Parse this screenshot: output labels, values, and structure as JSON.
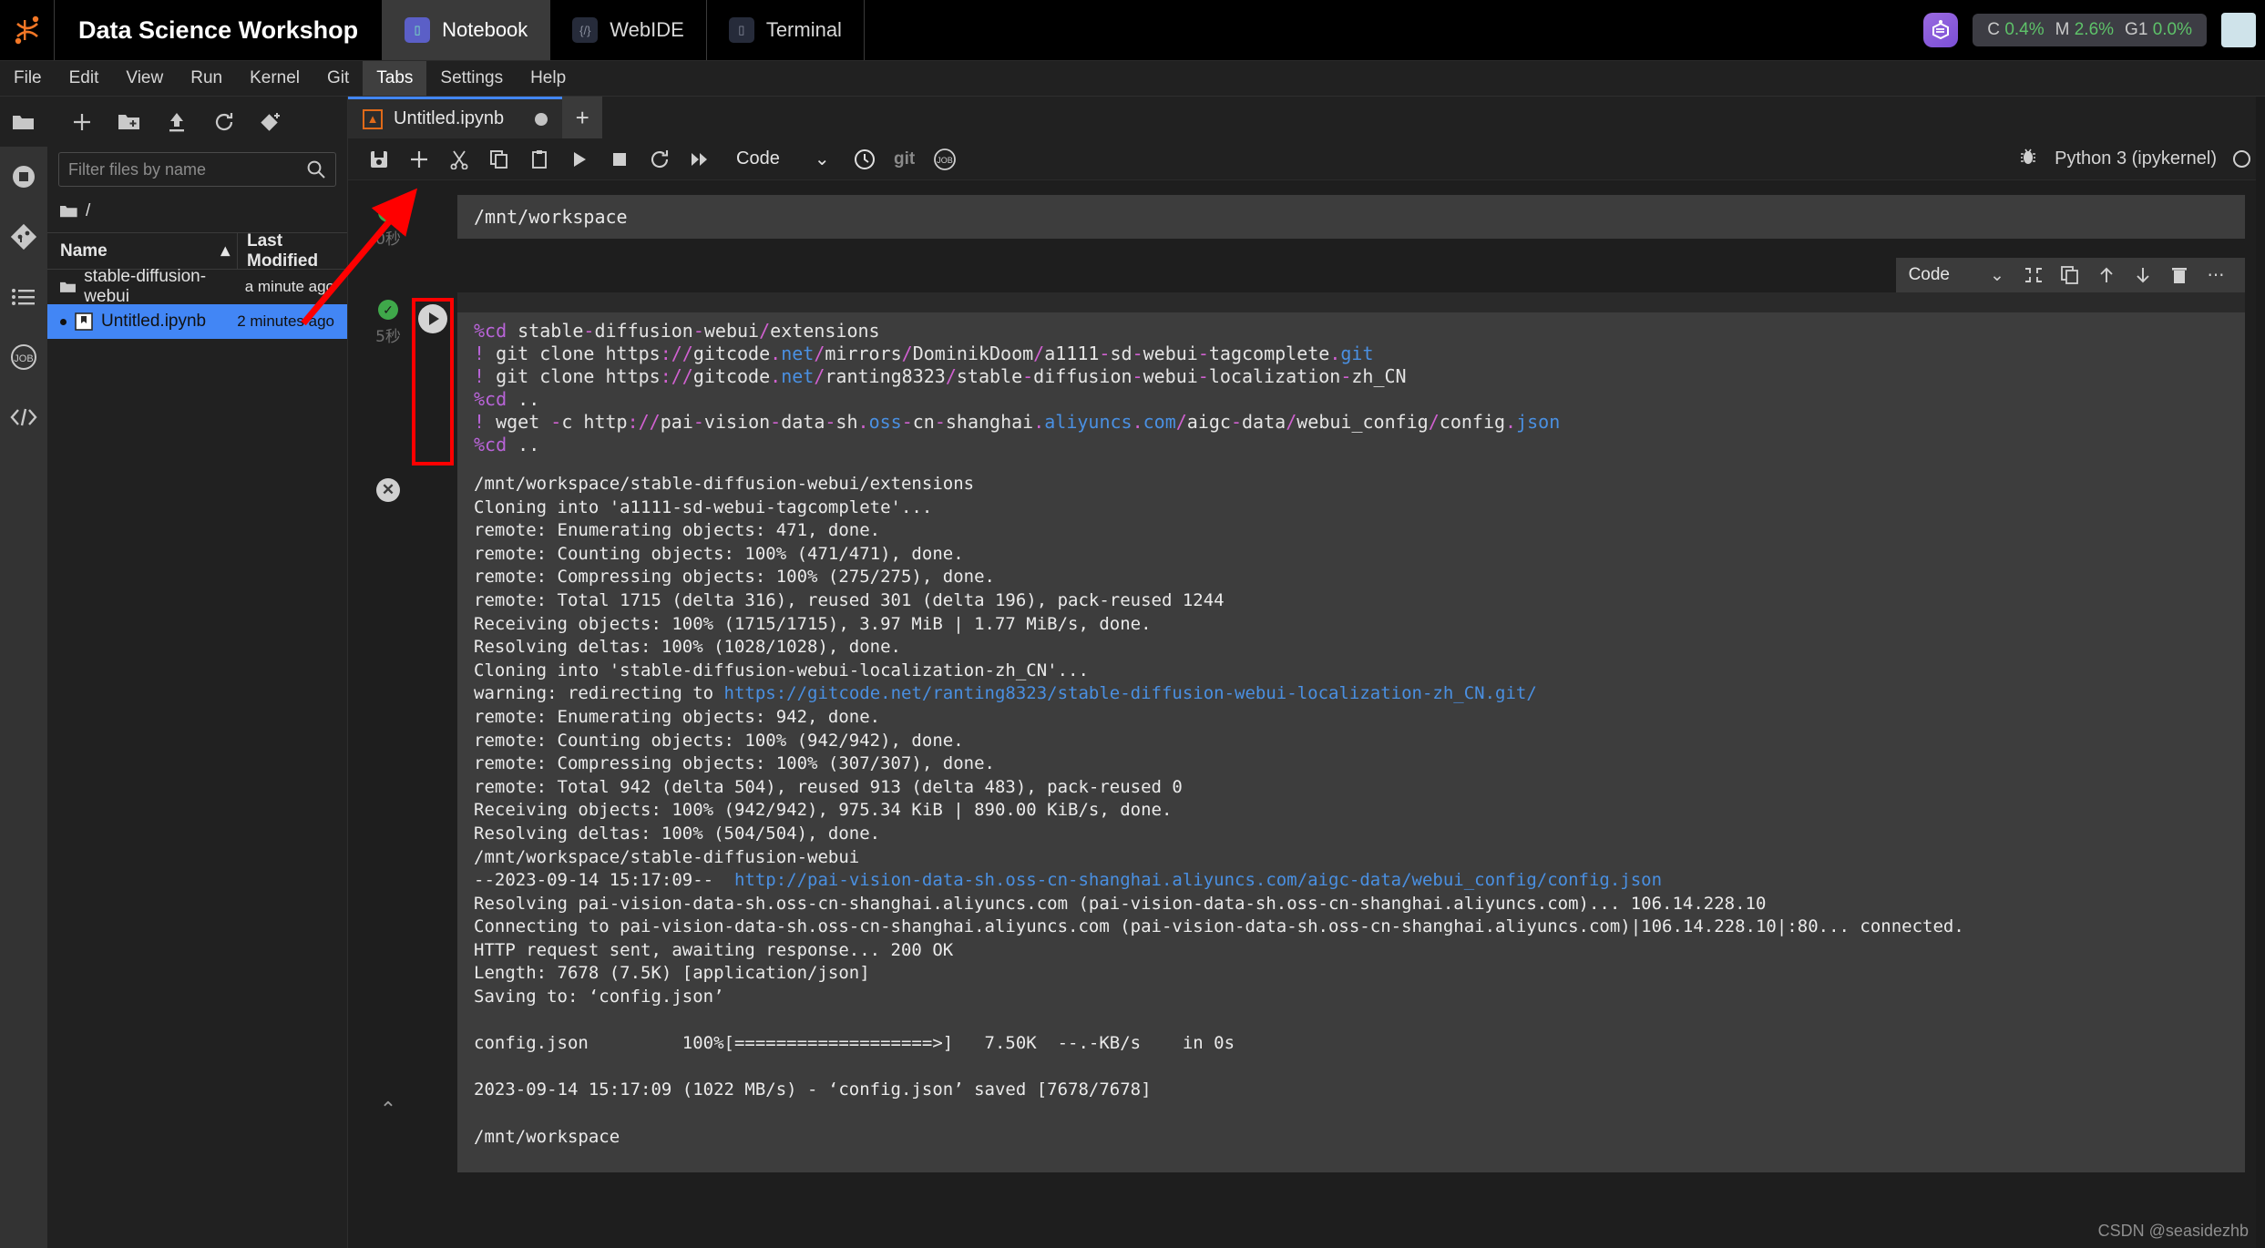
{
  "topbar": {
    "logo_icon": "jupyter-logo-icon",
    "brand": "Data Science Workshop",
    "nav": [
      {
        "label": "Notebook",
        "icon": "notebook-icon",
        "active": true
      },
      {
        "label": "WebIDE",
        "icon": "webide-icon",
        "active": false
      },
      {
        "label": "Terminal",
        "icon": "terminal-icon",
        "active": false
      }
    ],
    "resources": [
      {
        "key": "C",
        "value": "0.4%"
      },
      {
        "key": "M",
        "value": "2.6%"
      },
      {
        "key": "G1",
        "value": "0.0%"
      }
    ],
    "assistant_icon": "ai-assistant-icon",
    "avatar_icon": "user-avatar-icon"
  },
  "menubar": {
    "items": [
      "File",
      "Edit",
      "View",
      "Run",
      "Kernel",
      "Git",
      "Tabs",
      "Settings",
      "Help"
    ],
    "active": "Tabs"
  },
  "rail": {
    "items": [
      {
        "icon": "folder-icon",
        "name": "file-browser"
      },
      {
        "icon": "running-terminals-icon",
        "name": "running"
      },
      {
        "icon": "git-icon",
        "name": "git-panel"
      },
      {
        "icon": "table-of-contents-icon",
        "name": "toc"
      },
      {
        "icon": "job-icon",
        "name": "jobs"
      },
      {
        "icon": "code-extensions-icon",
        "name": "extensions"
      }
    ]
  },
  "filebrowser": {
    "toolbar": [
      {
        "icon": "new-launcher-icon",
        "name": "new-launcher"
      },
      {
        "icon": "new-folder-icon",
        "name": "new-folder"
      },
      {
        "icon": "upload-icon",
        "name": "upload"
      },
      {
        "icon": "refresh-icon",
        "name": "refresh"
      },
      {
        "icon": "new-checkpoint-icon",
        "name": "git-clone"
      }
    ],
    "filter_placeholder": "Filter files by name",
    "filter_value": "",
    "search_icon": "search-icon",
    "breadcrumb": "/",
    "columns": [
      "Name",
      "Last Modified"
    ],
    "sort_icon": "sort-asc-icon",
    "rows": [
      {
        "name": "stable-diffusion-webui",
        "modified": "a minute ago",
        "type": "folder",
        "selected": false,
        "dirty": false
      },
      {
        "name": "Untitled.ipynb",
        "modified": "2 minutes ago",
        "type": "notebook",
        "selected": true,
        "dirty": true
      }
    ]
  },
  "editor": {
    "tab": {
      "title": "Untitled.ipynb",
      "icon": "notebook-file-icon",
      "dirty": true
    },
    "add_tab_label": "+",
    "toolbar": {
      "buttons": [
        {
          "icon": "save-icon",
          "name": "save-notebook"
        },
        {
          "icon": "plus-icon",
          "name": "insert-cell"
        },
        {
          "icon": "cut-icon",
          "name": "cut-cell"
        },
        {
          "icon": "copy-icon",
          "name": "copy-cell"
        },
        {
          "icon": "paste-icon",
          "name": "paste-cell"
        },
        {
          "icon": "run-icon",
          "name": "run-cell"
        },
        {
          "icon": "stop-icon",
          "name": "interrupt-kernel"
        },
        {
          "icon": "restart-icon",
          "name": "restart-kernel"
        },
        {
          "icon": "fast-forward-icon",
          "name": "restart-run-all"
        }
      ],
      "cell_type": "Code",
      "chevron_icon": "chevron-down-icon",
      "clock_icon": "clock-icon",
      "git_label": "git",
      "job_label": "JOB",
      "debug_icon": "bug-icon",
      "kernel_name": "Python 3 (ipykernel)",
      "kernel_status_icon": "kernel-idle-icon"
    },
    "cell_toolbar": {
      "cell_type": "Code",
      "chevron_icon": "chevron-down-icon",
      "buttons": [
        {
          "icon": "collapse-icon",
          "name": "collapse-cell"
        },
        {
          "icon": "duplicate-icon",
          "name": "duplicate-cell"
        },
        {
          "icon": "move-up-icon",
          "name": "move-cell-up"
        },
        {
          "icon": "move-down-icon",
          "name": "move-cell-down"
        },
        {
          "icon": "trash-icon",
          "name": "delete-cell"
        },
        {
          "icon": "more-icon",
          "name": "more-actions"
        }
      ]
    },
    "cells": [
      {
        "status_icon": "check-success-icon",
        "exec_time": "0秒",
        "lines": [
          {
            "text": "/mnt/workspace",
            "kind": "plain"
          }
        ]
      },
      {
        "status_icon": "check-success-icon",
        "exec_time": "5秒",
        "run_button_icon": "run-cell-play-icon",
        "run_button_highlighted": true,
        "source_lines": [
          "%cd stable-diffusion-webui/extensions",
          "! git clone https://gitcode.net/mirrors/DominikDoom/a1111-sd-webui-tagcomplete.git",
          "! git clone https://gitcode.net/ranting8323/stable-diffusion-webui-localization-zh_CN",
          "%cd ..",
          "! wget -c http://pai-vision-data-sh.oss-cn-shanghai.aliyuncs.com/aigc-data/webui_config/config.json",
          "%cd .."
        ]
      }
    ],
    "output": {
      "status_icon": "error-x-icon",
      "collapse_icon": "collapse-output-icon",
      "lines": [
        "/mnt/workspace/stable-diffusion-webui/extensions",
        "Cloning into 'a1111-sd-webui-tagcomplete'...",
        "remote: Enumerating objects: 471, done.",
        "remote: Counting objects: 100% (471/471), done.",
        "remote: Compressing objects: 100% (275/275), done.",
        "remote: Total 1715 (delta 316), reused 301 (delta 196), pack-reused 1244",
        "Receiving objects: 100% (1715/1715), 3.97 MiB | 1.77 MiB/s, done.",
        "Resolving deltas: 100% (1028/1028), done.",
        "Cloning into 'stable-diffusion-webui-localization-zh_CN'...",
        "warning: redirecting to https://gitcode.net/ranting8323/stable-diffusion-webui-localization-zh_CN.git/",
        "remote: Enumerating objects: 942, done.",
        "remote: Counting objects: 100% (942/942), done.",
        "remote: Compressing objects: 100% (307/307), done.",
        "remote: Total 942 (delta 504), reused 913 (delta 483), pack-reused 0",
        "Receiving objects: 100% (942/942), 975.34 KiB | 890.00 KiB/s, done.",
        "Resolving deltas: 100% (504/504), done.",
        "/mnt/workspace/stable-diffusion-webui",
        "--2023-09-14 15:17:09--  http://pai-vision-data-sh.oss-cn-shanghai.aliyuncs.com/aigc-data/webui_config/config.json",
        "Resolving pai-vision-data-sh.oss-cn-shanghai.aliyuncs.com (pai-vision-data-sh.oss-cn-shanghai.aliyuncs.com)... 106.14.228.10",
        "Connecting to pai-vision-data-sh.oss-cn-shanghai.aliyuncs.com (pai-vision-data-sh.oss-cn-shanghai.aliyuncs.com)|106.14.228.10|:80... connected.",
        "HTTP request sent, awaiting response... 200 OK",
        "Length: 7678 (7.5K) [application/json]",
        "Saving to: ‘config.json’",
        "",
        "config.json         100%[===================>]   7.50K  --.-KB/s    in 0s",
        "",
        "2023-09-14 15:17:09 (1022 MB/s) - ‘config.json’ saved [7678/7678]",
        "",
        "/mnt/workspace"
      ],
      "link_lines": [
        9,
        17
      ]
    }
  },
  "annotation": {
    "arrow_color": "#ff0000",
    "highlight_color": "#ff0000"
  },
  "watermark": "CSDN @seasidezhb"
}
